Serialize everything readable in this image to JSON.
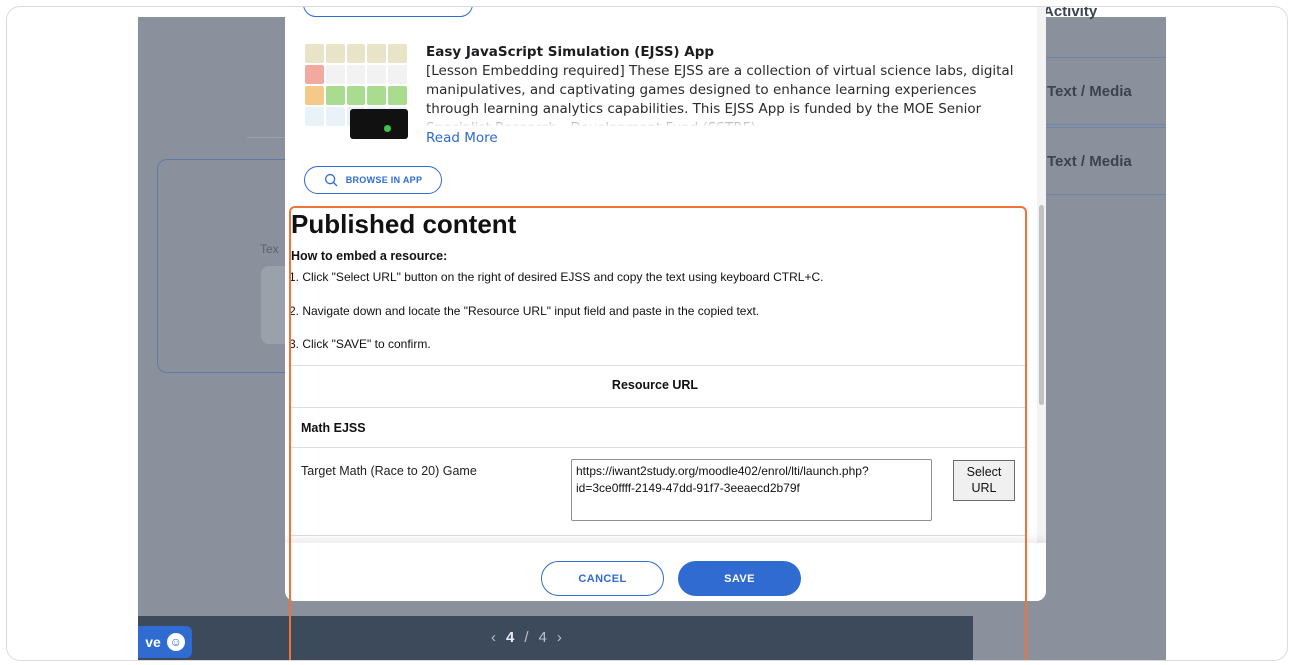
{
  "background": {
    "right_panel": {
      "top_item": "Activity",
      "items": [
        "Text / Media",
        "Text / Media"
      ]
    },
    "card_label": "Tex",
    "pager": {
      "current": "4",
      "separator": "/",
      "total": "4"
    },
    "feedback_label": "ve"
  },
  "app": {
    "title": "Easy JavaScript Simulation (EJSS) App",
    "description": "[Lesson Embedding required] These EJSS are a collection of virtual science labs, digital manipulatives, and captivating games designed to enhance learning experiences through learning analytics capabilities. This EJSS App is funded by the MOE Senior Specialist Research - Development Fund (SSTRF)",
    "read_more": "Read More",
    "browse_button": "BROWSE IN APP"
  },
  "published": {
    "title": "Published content",
    "howto_heading": "How to embed a resource:",
    "steps": [
      "1. Click \"Select URL\" button on the right of desired EJSS and copy the text using keyboard CTRL+C.",
      "2. Navigate down and locate the \"Resource URL\" input field and paste in the copied text.",
      "3. Click \"SAVE\" to confirm."
    ],
    "table": {
      "column_header": "Resource URL",
      "category": "Math EJSS",
      "rows": [
        {
          "name": "Target Math (Race to 20) Game",
          "url": "https://iwant2study.org/moodle402/enrol/lti/launch.php?id=3ce0ffff-2149-47dd-91f7-3eeaecd2b79f",
          "select_label": "Select URL"
        }
      ]
    }
  },
  "footer": {
    "cancel_label": "CANCEL",
    "save_label": "SAVE"
  },
  "colors": {
    "accent": "#2f6bd1",
    "highlight": "#f0743a",
    "overlay": "#8a919c"
  }
}
